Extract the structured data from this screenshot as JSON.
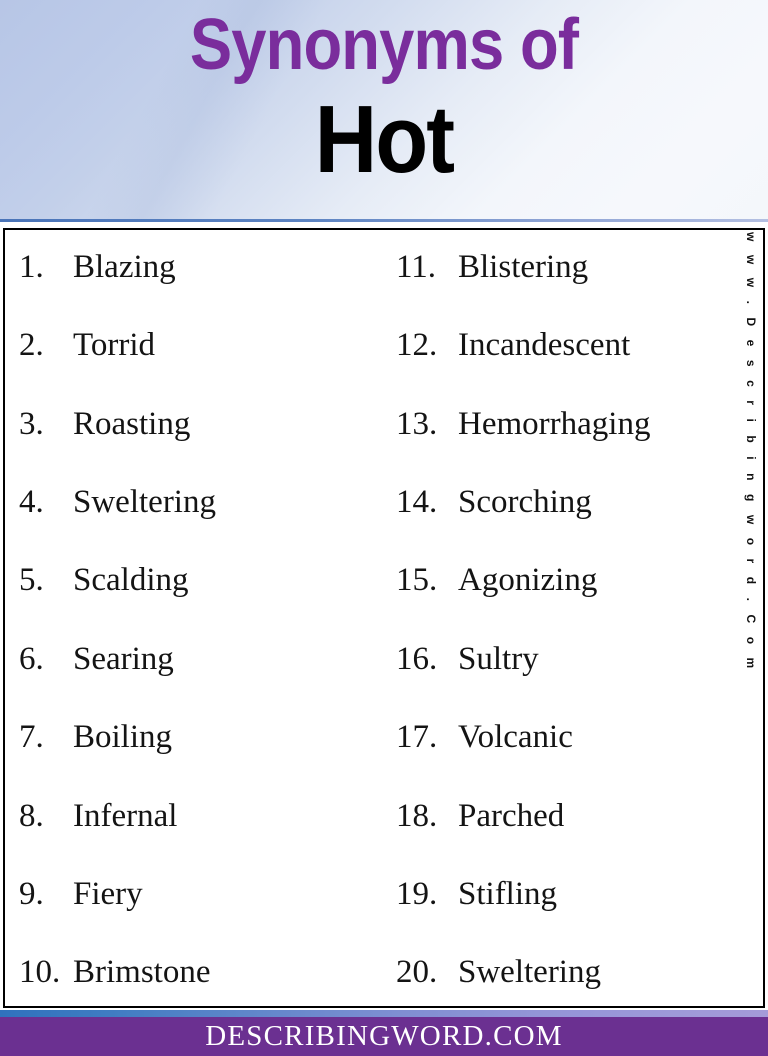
{
  "header": {
    "title_line1": "Synonyms of",
    "title_line2": "Hot",
    "title_color": "#7a2d9c",
    "word_color": "#000000",
    "bg_from": "#b7c6e6",
    "bg_to": "#f6f8fc"
  },
  "side_watermark": {
    "text": "w w w . D e s c r i b i n g w o r d . C o m"
  },
  "list": {
    "left_column": [
      {
        "num": "1.",
        "word": "Blazing"
      },
      {
        "num": "2.",
        "word": "Torrid"
      },
      {
        "num": "3.",
        "word": "Roasting"
      },
      {
        "num": "4.",
        "word": "Sweltering"
      },
      {
        "num": "5.",
        "word": "Scalding"
      },
      {
        "num": "6.",
        "word": "Searing"
      },
      {
        "num": "7.",
        "word": "Boiling"
      },
      {
        "num": "8.",
        "word": "Infernal"
      },
      {
        "num": "9.",
        "word": "Fiery"
      },
      {
        "num": "10.",
        "word": "Brimstone"
      }
    ],
    "right_column": [
      {
        "num": "11.",
        "word": "Blistering"
      },
      {
        "num": "12.",
        "word": "Incandescent"
      },
      {
        "num": "13.",
        "word": "Hemorrhaging"
      },
      {
        "num": "14.",
        "word": "Scorching"
      },
      {
        "num": "15.",
        "word": "Agonizing"
      },
      {
        "num": "16.",
        "word": "Sultry"
      },
      {
        "num": "17.",
        "word": "Volcanic"
      },
      {
        "num": "18.",
        "word": "Parched"
      },
      {
        "num": "19.",
        "word": "Stifling"
      },
      {
        "num": "20.",
        "word": "Sweltering"
      }
    ]
  },
  "footer": {
    "text": "DESCRIBINGWORD.COM",
    "bar_color": "#6b3091",
    "text_color": "#ffffff",
    "strip_from": "#2f72bd",
    "strip_to": "#a49bd9"
  }
}
